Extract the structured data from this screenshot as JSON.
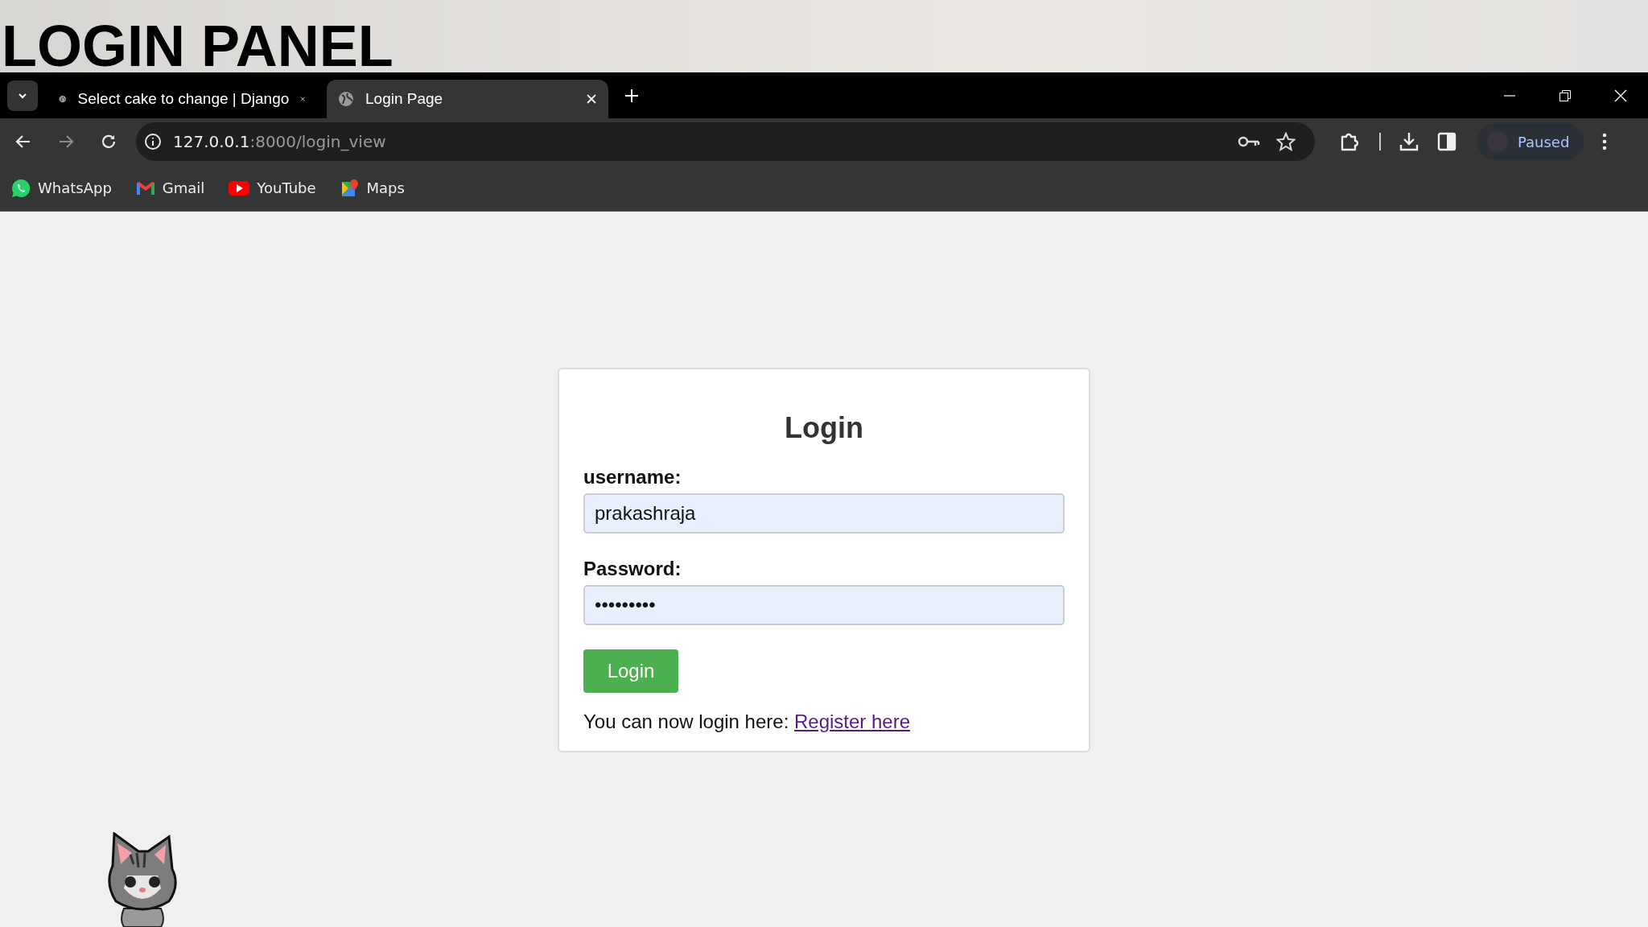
{
  "heading": "LOGIN PANEL",
  "tabs": [
    {
      "title": "Select cake to change | Django",
      "selected": false
    },
    {
      "title": "Login Page",
      "selected": true
    }
  ],
  "address": {
    "host": "127.0.0.1",
    "path": ":8000/login_view"
  },
  "profile": {
    "label": "Paused"
  },
  "bookmarks": [
    {
      "label": "WhatsApp",
      "kind": "whatsapp"
    },
    {
      "label": "Gmail",
      "kind": "gmail"
    },
    {
      "label": "YouTube",
      "kind": "youtube"
    },
    {
      "label": "Maps",
      "kind": "maps"
    }
  ],
  "form": {
    "title": "Login",
    "fields": [
      {
        "label": "username:",
        "value": "prakashraja"
      },
      {
        "label": "Password:",
        "value": "•••••••••"
      }
    ],
    "button": "Login",
    "footer": "You can now login here:",
    "link": "Register here"
  }
}
